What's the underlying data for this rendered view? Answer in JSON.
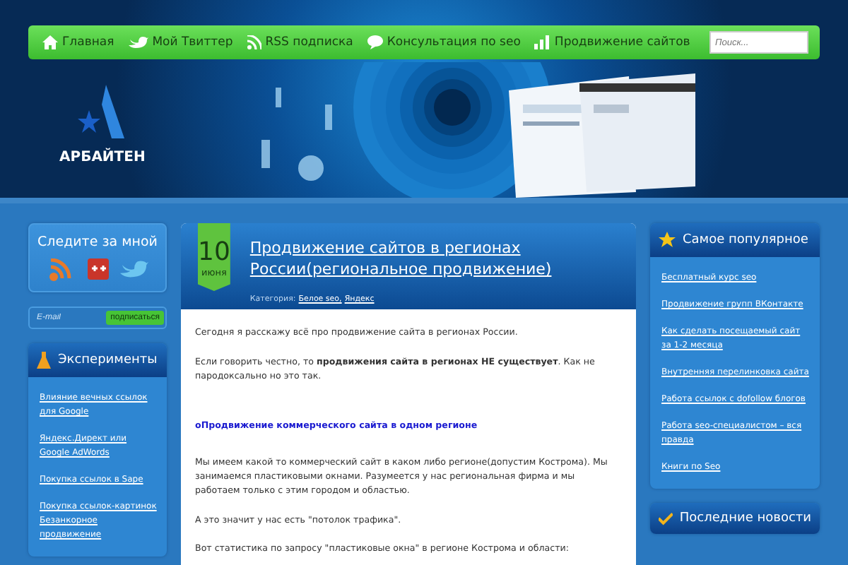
{
  "nav": {
    "items": [
      {
        "label": "Главная",
        "kind": "home"
      },
      {
        "label": "Мой Твиттер",
        "kind": "bird"
      },
      {
        "label": "RSS подписка",
        "kind": "rss"
      },
      {
        "label": "Консультация по seo",
        "kind": "chat"
      },
      {
        "label": "Продвижение сайтов",
        "kind": "chart"
      }
    ],
    "search": {
      "placeholder": "Поиск..."
    }
  },
  "logo": {
    "name": "АРБАЙТЕН"
  },
  "left": {
    "follow": {
      "title": "Следите за мной"
    },
    "subscribe": {
      "placeholder": "E-mail",
      "button": "подписаться"
    },
    "experiments": {
      "title": "Эксперименты",
      "links": [
        "Влияние вечных ссылок для Google",
        "Яндекс.Директ или Google AdWords",
        "Покупка ссылок в Sape",
        "Покупка ссылок-картинок Безанкорное продвижение"
      ]
    }
  },
  "post": {
    "day": "10",
    "month": "июня",
    "title": "Продвижение сайтов в регионах России(региональное продвижение)",
    "category_label": "Категория:",
    "categories": [
      "Белое seo,",
      "Яндекс"
    ],
    "paragraphs": [
      {
        "kind": "text",
        "text": "Сегодня я расскажу всё про продвижение сайта в регионах России."
      },
      {
        "kind": "text",
        "text": "Если говорить честно, то **продвижения сайта в регионах НЕ существует**. Как не пародоксально но это так."
      },
      {
        "kind": "heading",
        "text": "оПродвижение коммерческого сайта в одном регионе"
      },
      {
        "kind": "text",
        "text": "Мы имеем какой то коммерческий сайт в каком либо регионе(допустим Кострома). Мы занимаемся пластиковыми окнами. Разумеется у нас региональная фирма и мы работаем только с этим городом и областью."
      },
      {
        "kind": "line",
        "text": "А это значит у нас есть \"потолок трафика\"."
      },
      {
        "kind": "text",
        "text": "Вот статистика по запросу \"пластиковые окна\" в регионе Кострома и области:"
      }
    ]
  },
  "right": {
    "popular": {
      "title": "Самое популярное",
      "links": [
        "Бесплатный курс seo",
        "Продвижение групп ВКонтакте",
        "Как сделать посещаемый сайт за 1-2 месяца",
        "Внутренняя перелинковка сайта",
        "Работа ссылок с dofollow блогов",
        "Работа seo-специалистом – вся правда",
        "Книги по Seo"
      ]
    },
    "news": {
      "title": "Последние новости"
    }
  }
}
